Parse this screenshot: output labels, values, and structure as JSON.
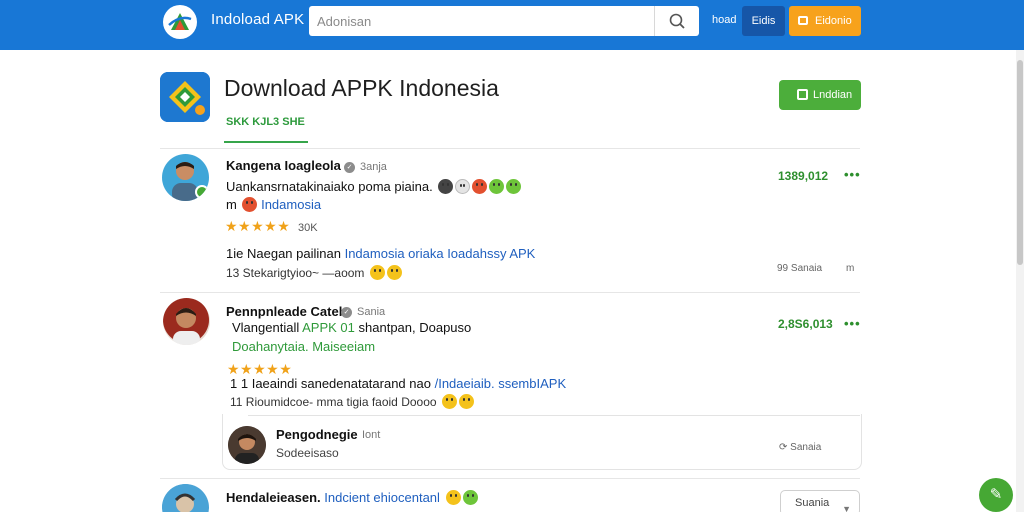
{
  "header": {
    "logo_text": "Indoload APK",
    "search_placeholder": "Adonisan",
    "nav_link": "hoad",
    "button_dark": "Eidis",
    "button_orange": "Eidonio"
  },
  "app": {
    "title": "Download APPK Indonesia",
    "subtitle": "SKK KJL3 SHE",
    "download_label": "Lnddian"
  },
  "reviews": [
    {
      "name": "Kangena Ioagleola",
      "time": "3anja",
      "text1": "Uankansrnatakinaiako poma piaina.",
      "text2_prefix": "m",
      "text2": "Indamosia",
      "stars": "★★★★★",
      "count": "30K",
      "line3_prefix": "1ie",
      "line3_text": "Naegan pailinan",
      "line3_blue": "Indamosia oriaka Ioadahssy APK",
      "line4": "13 Stekarigtyioo~",
      "line4_b": "—aoom",
      "score": "1389,012",
      "dots": "•••",
      "side_action": "99 Sanaia",
      "side_more": "m"
    },
    {
      "name": "Pennpnleade Catek",
      "time": "Sania",
      "text1a": "Vlangentiall",
      "text1b": "APPK 01",
      "text1c": "shantpan, Doapuso",
      "text2": "Doahanytaia. Maiseeiam",
      "stars": "★★★★★",
      "line3_prefix": "1 1",
      "line3_text": "Iaeaindi sanedenatatarand nao",
      "line3_blue": "/Indaeiaib. ssembIAPK",
      "line4": "11 Rioumidcoe- mma tigia faoid Doooo",
      "score": "2,8S6,013",
      "dots": "•••",
      "nested": {
        "name": "Pengodnegie",
        "time": "Iont",
        "text": "Sodeeisaso",
        "side_action": "Sanaia"
      }
    },
    {
      "name": "Hendaleieasen.",
      "name_blue": "Indcient ehiocentanl",
      "dropdown": "Suania"
    }
  ],
  "colors": {
    "topbar": "#1877d6",
    "accent_green": "#4cae3b",
    "accent_orange": "#f7a21c",
    "star": "#f0a21a"
  }
}
